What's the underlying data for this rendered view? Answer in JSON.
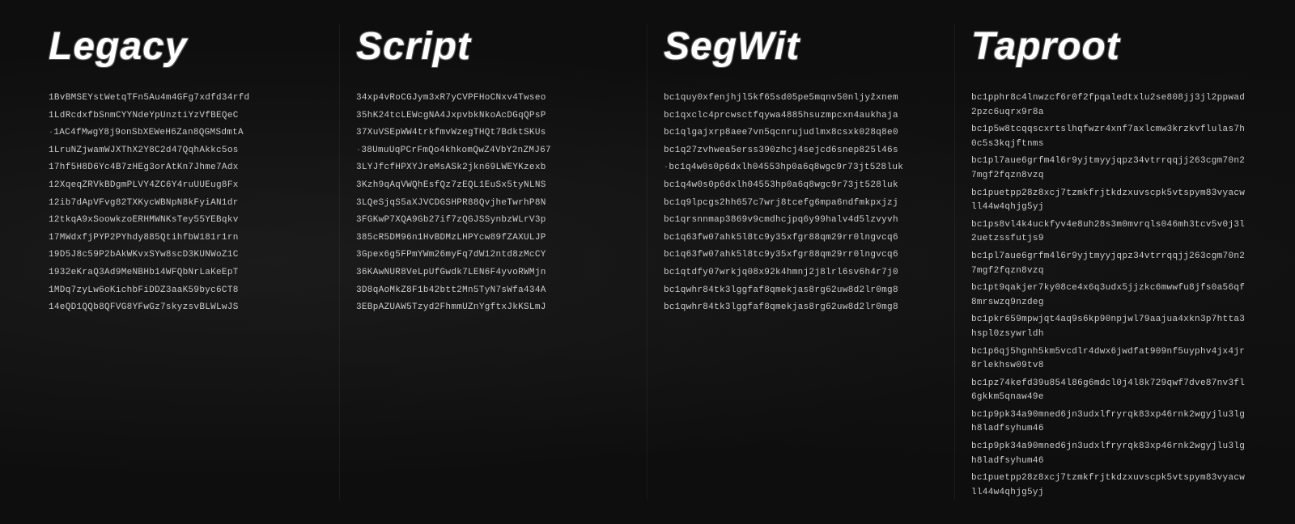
{
  "columns": [
    {
      "id": "legacy",
      "title": "Legacy",
      "addresses": [
        "1BvBMSEYstWetqTFn5Au4m4GFg7xdfd34rfd",
        "1LdRcdxfbSnmCYYNdeYpUnztiYzVfBEQeC",
        "1AC4fMwgY8j9onSbXEWeH6Zan8QGMSdmtA",
        "1LruNZjwamWJXThX2Y8C2d47QqhAkkc5os",
        "17hf5H8D6Yc4B7zHEg3orAtKn7Jhme7Adx",
        "12XqeqZRVkBDgmPLVY4ZC6Y4ruUUEug8Fx",
        "12ib7dApVFvg82TXKycWBNpN8kFyiAN1dr",
        "12tkqA9xSoowkzoERHMWNKsTey55YEBqkv",
        "17MWdxfjPYP2PYhdy885QtihfbW181r1rn",
        "19D5J8c59P2bAkWKvxSYw8scD3KUNWoZ1C",
        "1932eKraQ3Ad9MeNBHb14WFQbNrLaKeEpT",
        "1MDq7zyLw6oKichbFiDDZ3aaK59byc6CT8",
        "14eQD1QQb8QFVG8YFwGz7skyzsvBLWLwJS"
      ]
    },
    {
      "id": "script",
      "title": "Script",
      "addresses": [
        "34xp4vRoCGJym3xR7yCVPFHoCNxv4Twseo",
        "35hK24tcLEWcgNA4JxpvbkNkoAcDGqQPsP",
        "37XuVSEpWW4trkfmvWzegTHQt7BdktSKUs",
        "38UmuUqPCrFmQo4khkomQwZ4VbY2nZMJ67",
        "3LYJfcfHPXYJreMsASk2jkn69LWEYKzexb",
        "3Kzh9qAqVWQhEsfQz7zEQL1EuSx5tyNLNS",
        "3LQeSjqS5aXJVCDGSHPR88QvjheTwrhP8N",
        "3FGKwP7XQA9Gb27if7zQGJSSynbzWLrV3p",
        "385cR5DM96n1HvBDMzLHPYcw89fZAXULJP",
        "3Gpex6g5FPmYWm26myFq7dW12ntd8zMcCY",
        "36KAwNUR8VeLpUfGwdk7LEN6F4yvoRWMjn",
        "3D8qAoMkZ8F1b42btt2Mn5TyN7sWfa434A",
        "3EBpAZUAW5Tzyd2FhmmUZnYgftxJkKSLmJ"
      ]
    },
    {
      "id": "segwit",
      "title": "SegWit",
      "addresses": [
        "bc1quy0xfenjhjl5kf65sd05pe5mqnv50nljyžxnem",
        "bc1qxclc4prcwsctfqywa4885hsuzmpcxn4aukhaja",
        "bc1qlgajxrp8aee7vn5qcnrujudlmx8csxk028q8e0",
        "bc1q27zvhwea5erss390zhcj4sejcd6snep825l46s",
        "bc1q4w0s0p6dxlh04553hp0a6q8wgc9r73jt528luk",
        "bc1q4w0s0p6dxlh04553hp0a6q8wgc9r73jt528luk",
        "bc1q9lpcgs2hh657c7wrj8tcefg6mpa6ndfmkpxjzj",
        "bc1qrsnnmap3869v9cmdhcjpq6y99halv4d5lzvyvh",
        "bc1q63fw07ahk5l8tc9y35xfgr88qm29rr0lngvcq6",
        "bc1q63fw07ahk5l8tc9y35xfgr88qm29rr0lngvcq6",
        "bc1qtdfy07wrkjq08x92k4hmnj2j8lrl6sv6h4r7j0",
        "bc1qwhr84tk3lggfaf8qmekjas8rg62uw8d2lr0mg8",
        "bc1qwhr84tk3lggfaf8qmekjas8rg62uw8d2lr0mg8"
      ],
      "highlighted": [
        6,
        7
      ]
    },
    {
      "id": "taproot",
      "title": "Taproot",
      "addresses": [
        "bc1pphr8c4lnwzcf6r0f2fpqaledtxlu2se808jj3jl2ppwad2pzc6uqrx9r8a",
        "bc1p5w8tcqqscxrtslhqfwzr4xnf7axlcmw3krzkvflulas7h0c5s3kqjftnms",
        "bc1pl7aue6grfm4l6r9yjtmyyjqpz34vtrrqqjj263cgm70n27mgf2fqzn8vzq",
        "bc1puetpp28z8xcj7tzmkfrjtkdzxuvscpk5vtspym83vyacwll44w4qhjg5yj",
        "bc1ps8vl4k4uckfyv4e8uh28s3m0mvrqls046mh3tcv5v0j3l2uetzssfutjs9",
        "bc1pl7aue6grfm4l6r9yjtmyyjqpz34vtrrqqjj263cgm70n27mgf2fqzn8vzq",
        "bc1pt9qakjer7ky08ce4x6q3udx5jjzkc6mwwfu8jfs0a56qf8mrswzq9nzdeg",
        "bc1pkr659mpwjqt4aq9s6kp90npjwl79aajua4xkn3p7htta3hspl0zsywrldh",
        "bc1p6qj5hgnh5km5vcdlr4dwx6jwdfat909nf5uyphv4jx4jr8rlekhsw09tv8",
        "bc1pz74kefd39u854l86g6mdcl0j4l8k729qwf7dve87nv3fl6gkkm5qnaw49e",
        "bc1p9pk34a90mned6jn3udxlfryrqk83xp46rnk2wgyjlu3lgh8ladfsyhum46",
        "bc1p9pk34a90mned6jn3udxlfryrqk83xp46rnk2wgyjlu3lgh8ladfsyhum46",
        "bc1puetpp28z8xcj7tzmkfrjtkdzxuvscpk5vtspym83vyacwll44w4qhjg5yj"
      ]
    }
  ]
}
